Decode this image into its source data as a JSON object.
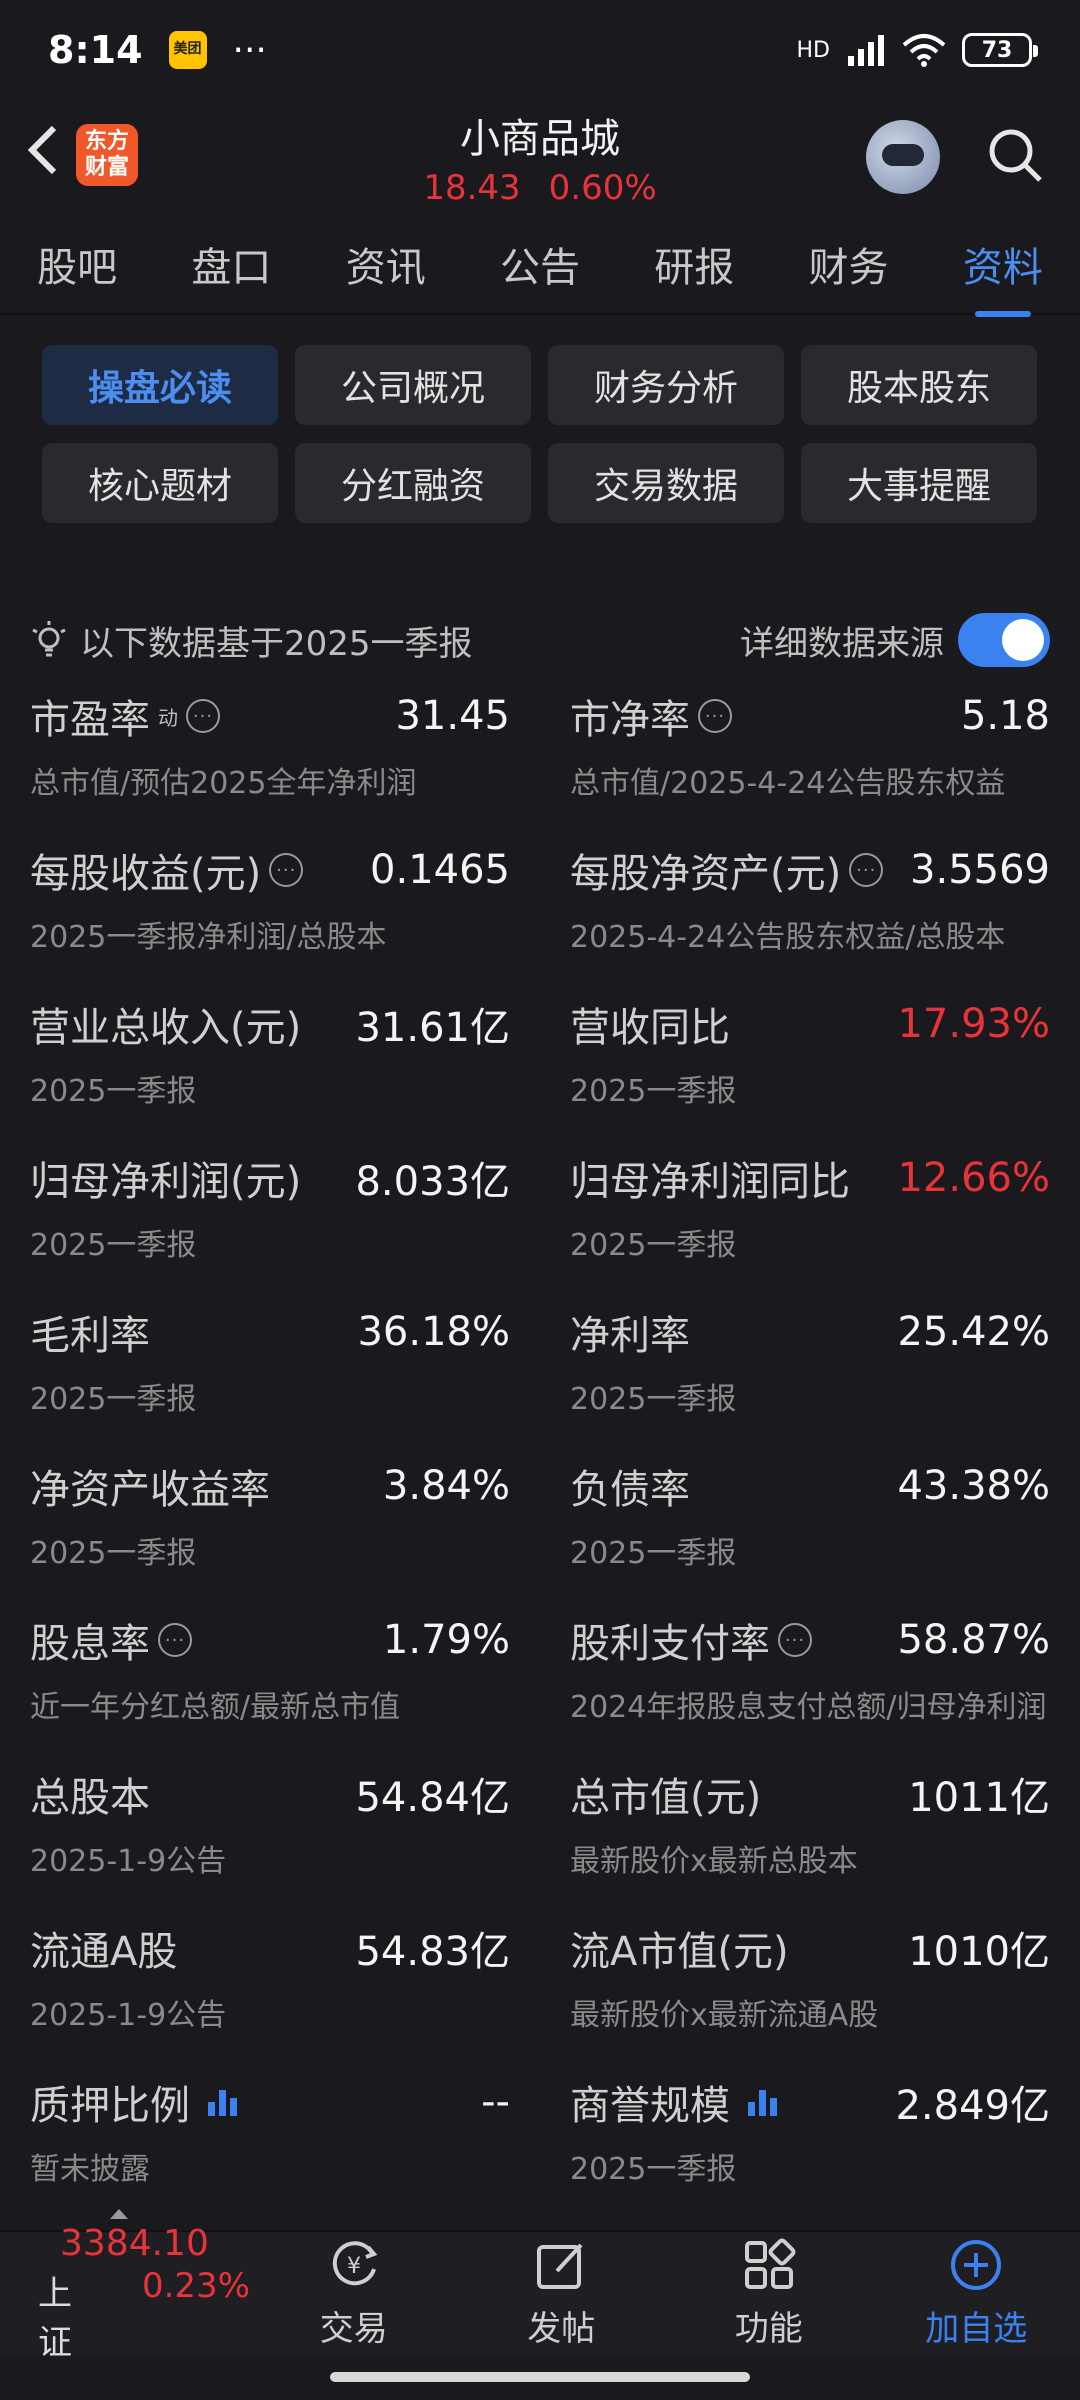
{
  "status": {
    "time": "8:14",
    "app_badge": "美团",
    "more": "···",
    "network": "HD",
    "battery": "73"
  },
  "header": {
    "logo_text": "东方财富",
    "stock_name": "小商品城",
    "price": "18.43",
    "change_pct": "0.60%"
  },
  "tabs": [
    {
      "label": "股吧"
    },
    {
      "label": "盘口"
    },
    {
      "label": "资讯"
    },
    {
      "label": "公告"
    },
    {
      "label": "研报"
    },
    {
      "label": "财务"
    },
    {
      "label": "资料",
      "active": true
    }
  ],
  "sections": [
    {
      "label": "操盘必读",
      "active": true
    },
    {
      "label": "公司概况"
    },
    {
      "label": "财务分析"
    },
    {
      "label": "股本股东"
    },
    {
      "label": "核心题材"
    },
    {
      "label": "分红融资"
    },
    {
      "label": "交易数据"
    },
    {
      "label": "大事提醒"
    }
  ],
  "info": {
    "note": "以下数据基于2025一季报",
    "source_label": "详细数据来源",
    "source_enabled": true
  },
  "metrics": [
    {
      "label": "市盈率",
      "sup": "动",
      "info": true,
      "value": "31.45",
      "sub": "总市值/预估2025全年净利润"
    },
    {
      "label": "市净率",
      "info": true,
      "value": "5.18",
      "sub": "总市值/2025-4-24公告股东权益"
    },
    {
      "label": "每股收益(元)",
      "info": true,
      "value": "0.1465",
      "sub": "2025一季报净利润/总股本"
    },
    {
      "label": "每股净资产(元)",
      "info": true,
      "value": "3.5569",
      "sub": "2025-4-24公告股东权益/总股本"
    },
    {
      "label": "营业总收入(元)",
      "value": "31.61亿",
      "sub": "2025一季报"
    },
    {
      "label": "营收同比",
      "value": "17.93%",
      "red": true,
      "sub": "2025一季报"
    },
    {
      "label": "归母净利润(元)",
      "value": "8.033亿",
      "sub": "2025一季报"
    },
    {
      "label": "归母净利润同比",
      "value": "12.66%",
      "red": true,
      "sub": "2025一季报"
    },
    {
      "label": "毛利率",
      "value": "36.18%",
      "sub": "2025一季报"
    },
    {
      "label": "净利率",
      "value": "25.42%",
      "sub": "2025一季报"
    },
    {
      "label": "净资产收益率",
      "value": "3.84%",
      "sub": "2025一季报"
    },
    {
      "label": "负债率",
      "value": "43.38%",
      "sub": "2025一季报"
    },
    {
      "label": "股息率",
      "info": true,
      "value": "1.79%",
      "sub": "近一年分红总额/最新总市值"
    },
    {
      "label": "股利支付率",
      "info": true,
      "value": "58.87%",
      "sub": "2024年报股息支付总额/归母净利润"
    },
    {
      "label": "总股本",
      "value": "54.84亿",
      "sub": "2025-1-9公告"
    },
    {
      "label": "总市值(元)",
      "value": "1011亿",
      "sub": "最新股价x最新总股本"
    },
    {
      "label": "流通A股",
      "value": "54.83亿",
      "sub": "2025-1-9公告"
    },
    {
      "label": "流A市值(元)",
      "value": "1010亿",
      "sub": "最新股价x最新流通A股"
    },
    {
      "label": "质押比例",
      "chart": true,
      "value": "--",
      "sub": "暂未披露"
    },
    {
      "label": "商誉规模",
      "chart": true,
      "value": "2.849亿",
      "sub": "2025一季报"
    }
  ],
  "bottom_nav": {
    "index_value": "3384.10",
    "index_name": "上证",
    "index_change": "0.23%",
    "items": [
      {
        "label": "交易",
        "icon": "trade-icon"
      },
      {
        "label": "发帖",
        "icon": "post-icon"
      },
      {
        "label": "功能",
        "icon": "grid-icon"
      },
      {
        "label": "加自选",
        "icon": "add-icon",
        "active": true
      }
    ]
  },
  "colors": {
    "accent": "#3b82f0",
    "up": "#e8333a",
    "background": "#1a1a1e"
  }
}
